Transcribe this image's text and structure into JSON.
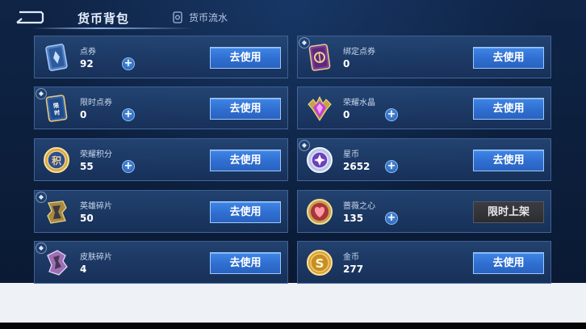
{
  "header": {
    "active_tab": "货币背包",
    "flow_tab": "货币流水"
  },
  "cards": [
    {
      "name": "点券",
      "count": "92",
      "has_plus": true,
      "button": "去使用",
      "icon": "ticket-card-icon",
      "marked": false
    },
    {
      "name": "绑定点券",
      "count": "0",
      "has_plus": false,
      "button": "去使用",
      "icon": "bound-ticket-card-icon",
      "marked": true
    },
    {
      "name": "限时点券",
      "count": "0",
      "has_plus": true,
      "button": "去使用",
      "icon": "limited-ticket-icon",
      "marked": true,
      "icon_text": "限时"
    },
    {
      "name": "荣耀水晶",
      "count": "0",
      "has_plus": true,
      "button": "去使用",
      "icon": "glory-crystal-icon",
      "marked": false
    },
    {
      "name": "荣耀积分",
      "count": "55",
      "has_plus": true,
      "button": "去使用",
      "icon": "glory-points-coin-icon",
      "marked": false,
      "icon_text": "积"
    },
    {
      "name": "星币",
      "count": "2652",
      "has_plus": true,
      "button": "去使用",
      "icon": "star-coin-icon",
      "marked": true
    },
    {
      "name": "英雄碎片",
      "count": "50",
      "has_plus": false,
      "button": "去使用",
      "icon": "hero-fragment-icon",
      "marked": true
    },
    {
      "name": "蔷薇之心",
      "count": "135",
      "has_plus": true,
      "button": "限时上架",
      "icon": "rose-heart-coin-icon",
      "marked": false
    },
    {
      "name": "皮肤碎片",
      "count": "4",
      "has_plus": false,
      "button": "去使用",
      "icon": "skin-fragment-icon",
      "marked": true
    },
    {
      "name": "金币",
      "count": "277",
      "has_plus": false,
      "button": "去使用",
      "icon": "gold-coin-icon",
      "marked": false,
      "icon_text": "S"
    }
  ],
  "colors": {
    "use_button": "#2f6ed0",
    "limited_button": "#2b2d31",
    "card_border": "#6e96d2"
  }
}
